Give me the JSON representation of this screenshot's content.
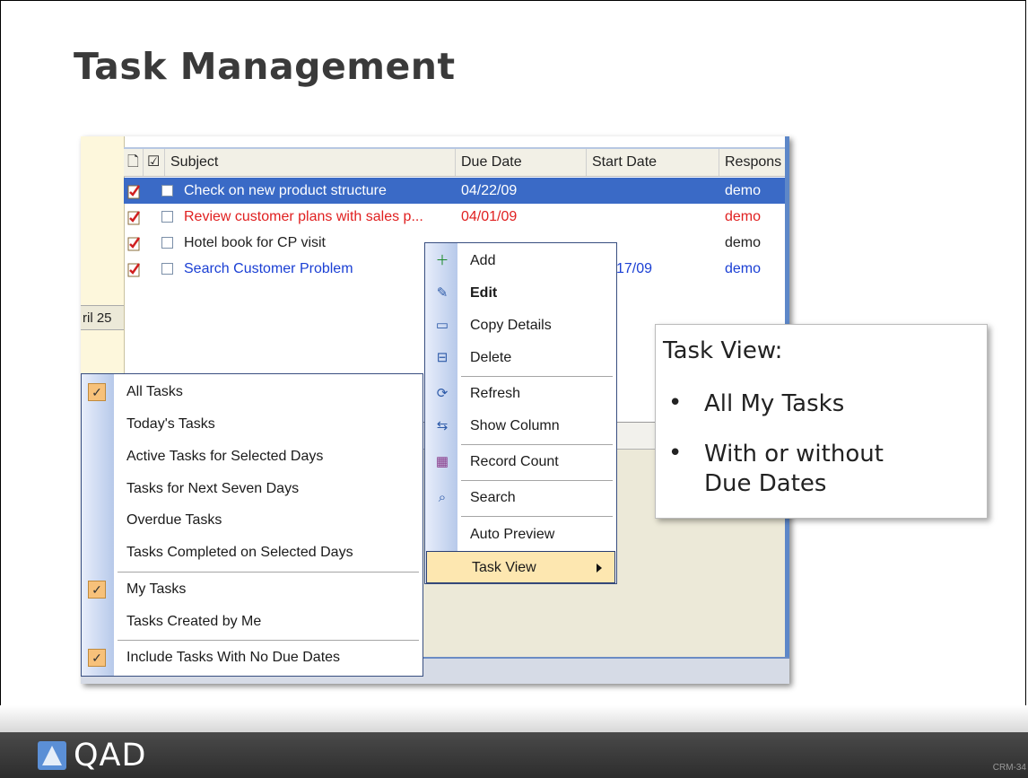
{
  "slide": {
    "title": "Task Management",
    "code": "CRM-34"
  },
  "calendar": {
    "label": "ril 25"
  },
  "grid": {
    "headers": [
      "Subject",
      "Due Date",
      "Start Date",
      "Respons"
    ],
    "rows": [
      {
        "subject": "Check on new product structure",
        "due": "04/22/09",
        "start": "",
        "resp": "demo",
        "style": "selected"
      },
      {
        "subject": "Review customer plans with sales p...",
        "due": "04/01/09",
        "start": "",
        "resp": "demo",
        "style": "overdue"
      },
      {
        "subject": "Hotel book for CP visit",
        "due": "",
        "start": "",
        "resp": "demo",
        "style": "normal"
      },
      {
        "subject": "Search Customer Problem",
        "due": "",
        "start": "17/09",
        "resp": "demo",
        "style": "blue"
      }
    ]
  },
  "task_view_menu": {
    "items": [
      {
        "label": "All Tasks",
        "checked": true
      },
      {
        "label": "Today's Tasks",
        "checked": false
      },
      {
        "label": "Active Tasks for Selected Days",
        "checked": false
      },
      {
        "label": "Tasks for Next Seven Days",
        "checked": false
      },
      {
        "label": "Overdue Tasks",
        "checked": false
      },
      {
        "label": "Tasks Completed on Selected Days",
        "checked": false
      },
      {
        "label": "My Tasks",
        "checked": true
      },
      {
        "label": "Tasks Created by Me",
        "checked": false
      },
      {
        "label": "Include Tasks With No Due Dates",
        "checked": true
      }
    ]
  },
  "context_menu": {
    "items": [
      {
        "label": "Add",
        "icon": "add-icon"
      },
      {
        "label": "Edit",
        "icon": "edit-icon"
      },
      {
        "label": "Copy Details",
        "icon": "copy-icon"
      },
      {
        "label": "Delete",
        "icon": "delete-icon"
      },
      {
        "label": "Refresh",
        "icon": "refresh-icon"
      },
      {
        "label": "Show Column",
        "icon": "columns-icon"
      },
      {
        "label": "Record Count",
        "icon": "record-count-icon"
      },
      {
        "label": "Search",
        "icon": "search-icon"
      },
      {
        "label": "Auto Preview",
        "icon": ""
      },
      {
        "label": "Task View",
        "icon": ""
      }
    ]
  },
  "callout": {
    "title": "Task View:",
    "bullets": [
      "All My Tasks",
      "With or without",
      "Due Dates"
    ]
  },
  "footer": {
    "brand": "QAD"
  },
  "colors": {
    "selected_row": "#3a6ac6",
    "overdue": "#e02020",
    "blue_task": "#1a3fd4",
    "menu_highlight": "#fde7b0"
  }
}
